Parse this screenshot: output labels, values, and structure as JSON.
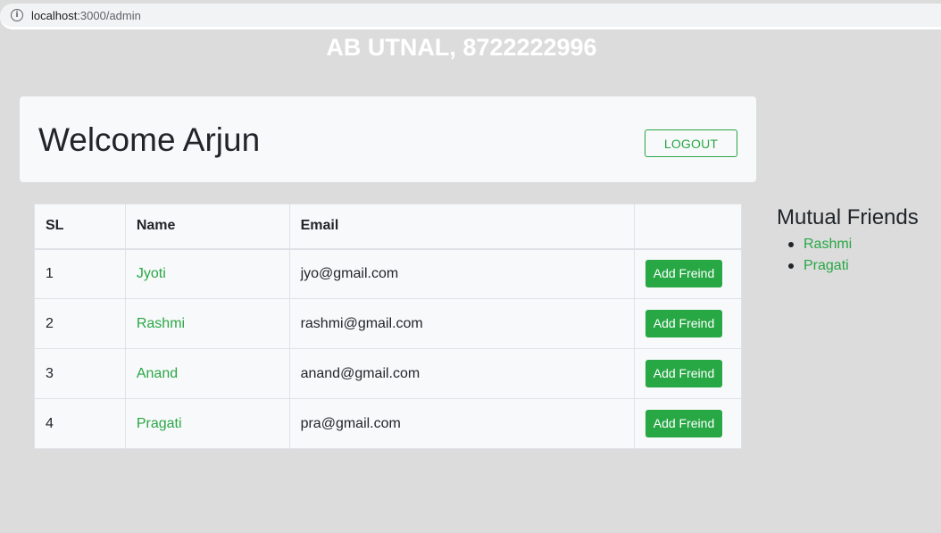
{
  "browser": {
    "url_host": "localhost",
    "url_path": ":3000/admin",
    "info_icon": "i"
  },
  "header": {
    "title": "AB UTNAL, 8722222996"
  },
  "jumbotron": {
    "welcome": "Welcome Arjun",
    "logout_label": "LOGOUT"
  },
  "table": {
    "headers": [
      "SL",
      "Name",
      "Email",
      ""
    ],
    "rows": [
      {
        "sl": "1",
        "name": "Jyoti",
        "email": "jyo@gmail.com",
        "action": "Add Freind"
      },
      {
        "sl": "2",
        "name": "Rashmi",
        "email": "rashmi@gmail.com",
        "action": "Add Freind"
      },
      {
        "sl": "3",
        "name": "Anand",
        "email": "anand@gmail.com",
        "action": "Add Freind"
      },
      {
        "sl": "4",
        "name": "Pragati",
        "email": "pra@gmail.com",
        "action": "Add Freind"
      }
    ]
  },
  "mutual_friends": {
    "title": "Mutual Friends",
    "items": [
      "Rashmi",
      "Pragati"
    ]
  },
  "colors": {
    "accent": "#28a745",
    "background": "#dcdcdc",
    "card": "#f8f9fa"
  }
}
